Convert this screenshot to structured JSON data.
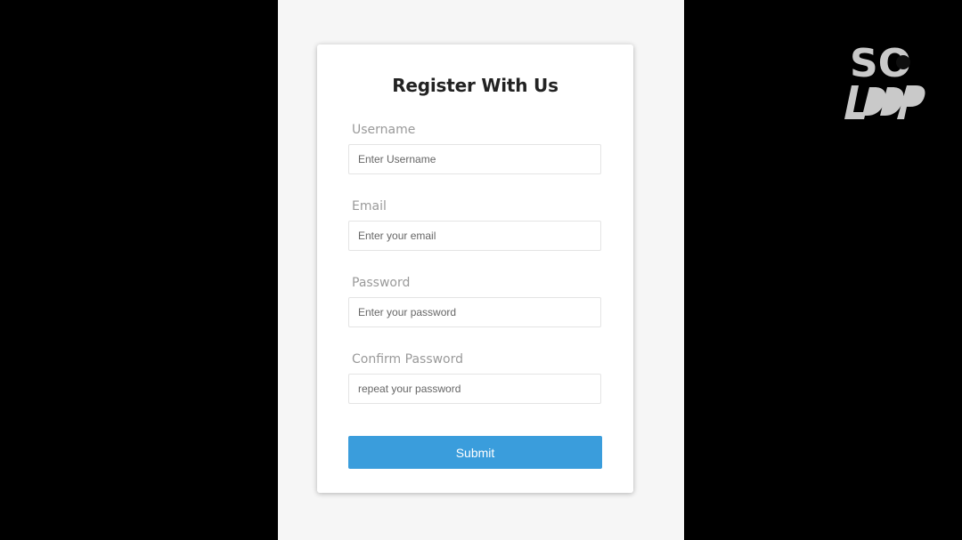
{
  "form": {
    "title": "Register With Us",
    "fields": [
      {
        "label": "Username",
        "placeholder": "Enter Username",
        "value": ""
      },
      {
        "label": "Email",
        "placeholder": "Enter your email",
        "value": ""
      },
      {
        "label": "Password",
        "placeholder": "Enter your password",
        "value": ""
      },
      {
        "label": "Confirm Password",
        "placeholder": "repeat your password",
        "value": ""
      }
    ],
    "submit_label": "Submit"
  },
  "logo": {
    "line1": "SO",
    "line2": "LOOP"
  },
  "colors": {
    "accent": "#3a9ddc",
    "page_background": "#f6f6f6",
    "outer_background": "#000000"
  }
}
